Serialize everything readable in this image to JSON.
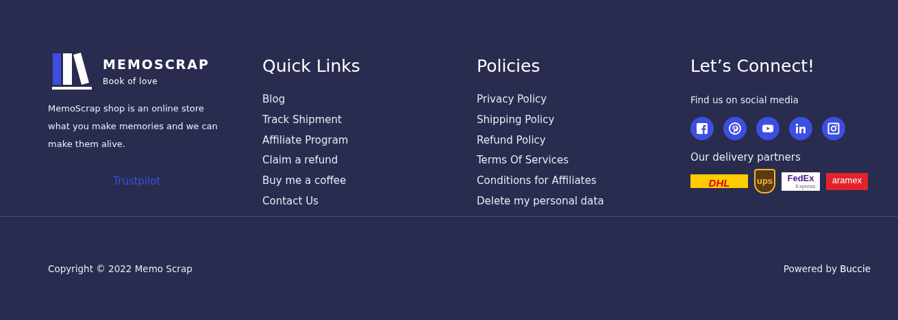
{
  "brand": {
    "name": "MEMOSCRAP",
    "tagline": "Book of love",
    "description": "MemoScrap shop is an online store what you make memories and we can make them alive.",
    "trustpilot": "Trustpilot"
  },
  "columns": [
    {
      "title": "Quick Links",
      "links": [
        "Blog",
        "Track Shipment",
        "Affiliate Program",
        "Claim a refund",
        "Buy me a coffee",
        "Contact Us"
      ]
    },
    {
      "title": "Policies",
      "links": [
        "Privacy Policy",
        "Shipping Policy",
        "Refund Policy",
        "Terms Of Services",
        "Conditions for Affiliates",
        "Delete my personal data"
      ]
    }
  ],
  "connect": {
    "title": "Let’s Connect!",
    "social_label": "Find us on social media",
    "social": [
      {
        "kind": "facebook"
      },
      {
        "kind": "pinterest"
      },
      {
        "kind": "youtube"
      },
      {
        "kind": "linkedin"
      },
      {
        "kind": "instagram"
      }
    ],
    "partners_label": "Our delivery partners",
    "partners": [
      {
        "kind": "dhl",
        "text": "DHL"
      },
      {
        "kind": "ups",
        "text": "ups"
      },
      {
        "kind": "fedex",
        "text": "FedEx",
        "sub": "Express"
      },
      {
        "kind": "aramex",
        "text": "aramex"
      }
    ]
  },
  "bottom": {
    "copyright": "Copyright © 2022 Memo Scrap",
    "powered": "Powered by **Buccie**"
  }
}
